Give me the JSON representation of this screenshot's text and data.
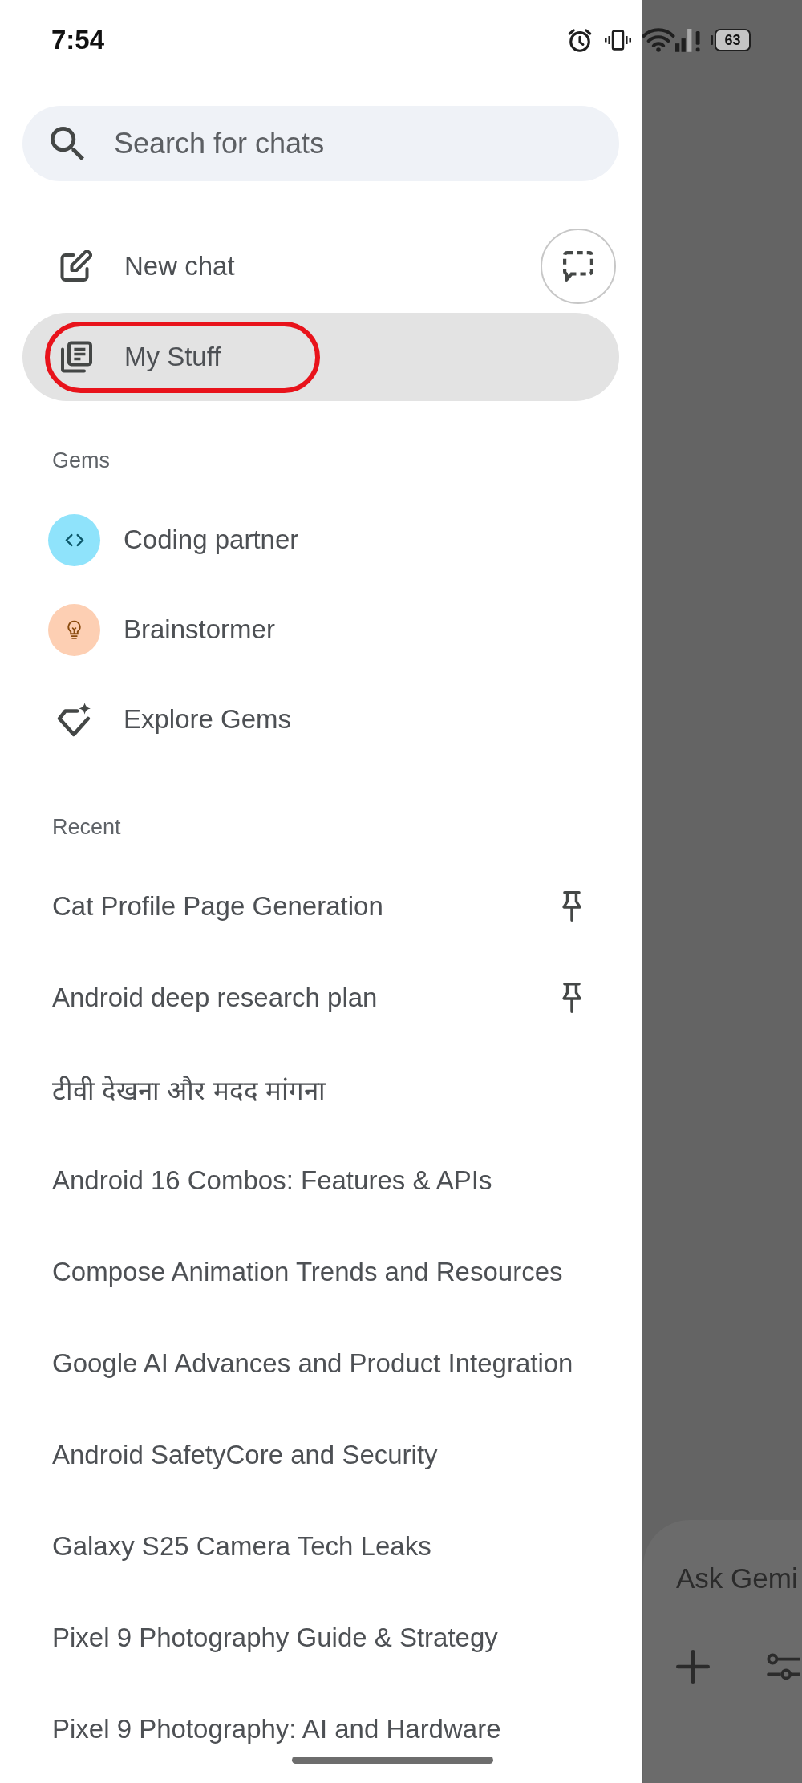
{
  "status_bar": {
    "time": "7:54",
    "battery": "63"
  },
  "search": {
    "placeholder": "Search for chats"
  },
  "menu": [
    {
      "kind": "new_chat",
      "label": "New chat",
      "selected": false,
      "circled": false
    },
    {
      "kind": "my_stuff",
      "label": "My Stuff",
      "selected": true,
      "circled": true
    }
  ],
  "gems": {
    "title": "Gems",
    "items": [
      {
        "kind": "coding",
        "label": "Coding partner",
        "color": "#8fe3fb"
      },
      {
        "kind": "idea",
        "label": "Brainstormer",
        "color": "#fdcfb3"
      },
      {
        "kind": "explore",
        "label": "Explore Gems"
      }
    ]
  },
  "recent": {
    "title": "Recent",
    "items": [
      {
        "label": "Cat Profile Page Generation",
        "pinned": true
      },
      {
        "label": "Android deep research plan",
        "pinned": true
      },
      {
        "label": "टीवी देखना और मदद मांगना",
        "pinned": false
      },
      {
        "label": "Android 16 Combos: Features & APIs",
        "pinned": false
      },
      {
        "label": "Compose Animation Trends and Resources",
        "pinned": false
      },
      {
        "label": "Google AI Advances and Product Integration",
        "pinned": false
      },
      {
        "label": "Android SafetyCore and Security",
        "pinned": false
      },
      {
        "label": "Galaxy S25 Camera Tech Leaks",
        "pinned": false
      },
      {
        "label": "Pixel 9 Photography Guide & Strategy",
        "pinned": false
      },
      {
        "label": "Pixel 9 Photography: AI and Hardware",
        "pinned": false
      }
    ]
  },
  "main": {
    "prompt": {
      "placeholder": "Ask Gemi"
    }
  }
}
